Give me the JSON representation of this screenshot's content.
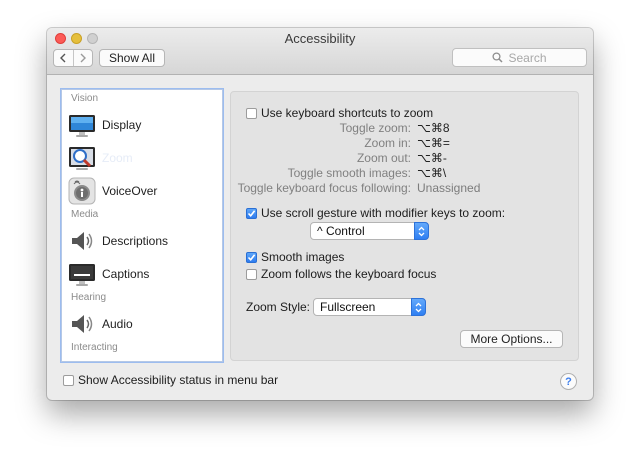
{
  "window": {
    "title": "Accessibility"
  },
  "toolbar": {
    "show_all_label": "Show All",
    "search_placeholder": "Search"
  },
  "sidebar": {
    "sections": [
      "Vision",
      "Media",
      "Hearing",
      "Interacting"
    ],
    "items": [
      {
        "label": "Display",
        "icon": "display-icon"
      },
      {
        "label": "Zoom",
        "icon": "zoom-icon",
        "selected": true
      },
      {
        "label": "VoiceOver",
        "icon": "voiceover-icon"
      },
      {
        "label": "Descriptions",
        "icon": "speaker-icon"
      },
      {
        "label": "Captions",
        "icon": "captions-icon"
      },
      {
        "label": "Audio",
        "icon": "speaker-icon"
      }
    ]
  },
  "zoom": {
    "keyboard_shortcuts": {
      "label": "Use keyboard shortcuts to zoom",
      "checked": false
    },
    "shortcuts": [
      {
        "label": "Toggle zoom:",
        "value": "⌥⌘8"
      },
      {
        "label": "Zoom in:",
        "value": "⌥⌘="
      },
      {
        "label": "Zoom out:",
        "value": "⌥⌘-"
      },
      {
        "label": "Toggle smooth images:",
        "value": "⌥⌘\\"
      },
      {
        "label": "Toggle keyboard focus following:",
        "value": "Unassigned"
      }
    ],
    "scroll_gesture": {
      "label": "Use scroll gesture with modifier keys to zoom:",
      "checked": true
    },
    "modifier_value": "^ Control",
    "smooth_images": {
      "label": "Smooth images",
      "checked": true
    },
    "follow_focus": {
      "label": "Zoom follows the keyboard focus",
      "checked": false
    },
    "zoom_style_label": "Zoom Style:",
    "zoom_style_value": "Fullscreen",
    "more_options_label": "More Options..."
  },
  "footer": {
    "status_menu": {
      "label": "Show Accessibility status in menu bar",
      "checked": false
    },
    "help_label": "?"
  },
  "colors": {
    "accent": "#2e7cf0",
    "selection": "#3b7ded"
  }
}
